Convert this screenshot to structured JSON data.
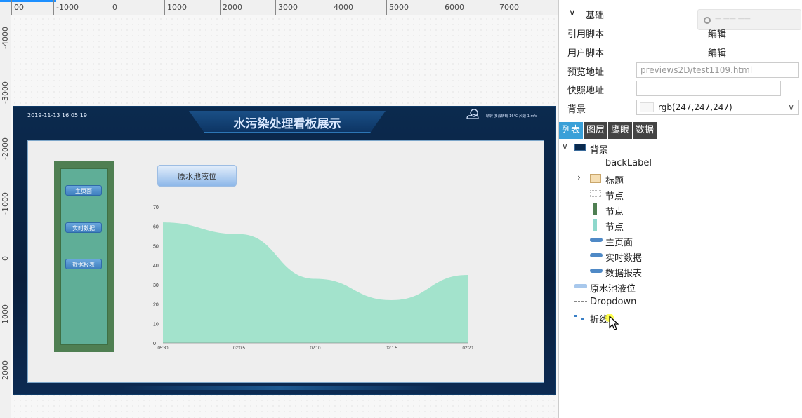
{
  "ruler_top": [
    "00",
    "-1000",
    "0",
    "1000",
    "2000",
    "3000",
    "4000",
    "5000",
    "6000",
    "7000"
  ],
  "ruler_left": [
    "-4000",
    "-3000",
    "-2000",
    "-1000",
    "0",
    "1000",
    "2000"
  ],
  "dashboard": {
    "timestamp": "2019-11-13 16:05:19",
    "title": "水污染处理看板展示",
    "weather": "晴转 多云转晴  16°C  风速  1 m/s",
    "nav_buttons": [
      "主页面",
      "实时数据",
      "数据报表"
    ],
    "water_button": "原水池液位"
  },
  "chart_data": {
    "type": "area",
    "x": [
      "05:30",
      "02:05",
      "02:10",
      "02:15",
      "02:20"
    ],
    "x_tick_labels": [
      "05:30",
      "02:0 5",
      "02:10",
      "02:1 5",
      "02:20"
    ],
    "values": [
      62,
      56,
      33,
      22,
      35
    ],
    "ylim": [
      0,
      70
    ],
    "y_ticks": [
      "70",
      "60",
      "50",
      "40",
      "30",
      "20",
      "10",
      "0"
    ],
    "fill_color": "#a3e3cc",
    "grid": false,
    "title": "",
    "xlabel": "",
    "ylabel": ""
  },
  "props": {
    "section_label": "基础",
    "ghost_hint": "— —— ——",
    "rows": [
      {
        "key": "引用脚本",
        "value": "编辑"
      },
      {
        "key": "用户脚本",
        "value": "编辑"
      },
      {
        "key": "预览地址",
        "value": "previews2D/test1109.html"
      },
      {
        "key": "快照地址",
        "value": ""
      },
      {
        "key": "背景",
        "value": "rgb(247,247,247)"
      }
    ]
  },
  "tabs": [
    {
      "label": "列表",
      "active": true
    },
    {
      "label": "图层",
      "active": false
    },
    {
      "label": "鹰眼",
      "active": false
    },
    {
      "label": "数据",
      "active": false
    }
  ],
  "tree": [
    {
      "label": "背景",
      "icon": "dark-rect-icon",
      "expanded": true
    },
    {
      "label": "backLabel",
      "icon": "none-icon"
    },
    {
      "label": "标题",
      "icon": "folder-icon",
      "expandable": true
    },
    {
      "label": "节点",
      "icon": "dotted-rect-icon"
    },
    {
      "label": "节点",
      "icon": "green-bar-icon"
    },
    {
      "label": "节点",
      "icon": "teal-bar-icon"
    },
    {
      "label": "主页面",
      "icon": "button-icon"
    },
    {
      "label": "实时数据",
      "icon": "button-icon"
    },
    {
      "label": "数据报表",
      "icon": "button-icon"
    },
    {
      "label": "原水池液位",
      "icon": "wide-button-icon"
    },
    {
      "label": "Dropdown",
      "icon": "dropdown-icon"
    },
    {
      "label": "折线",
      "icon": "line-icon"
    }
  ],
  "colors": {
    "accent": "#3aa0d8",
    "dash_bg": "#0b2a4e",
    "nav_green": "#4f7f52",
    "nav_inner": "#5fae97",
    "area_fill": "#a3e3cc"
  }
}
